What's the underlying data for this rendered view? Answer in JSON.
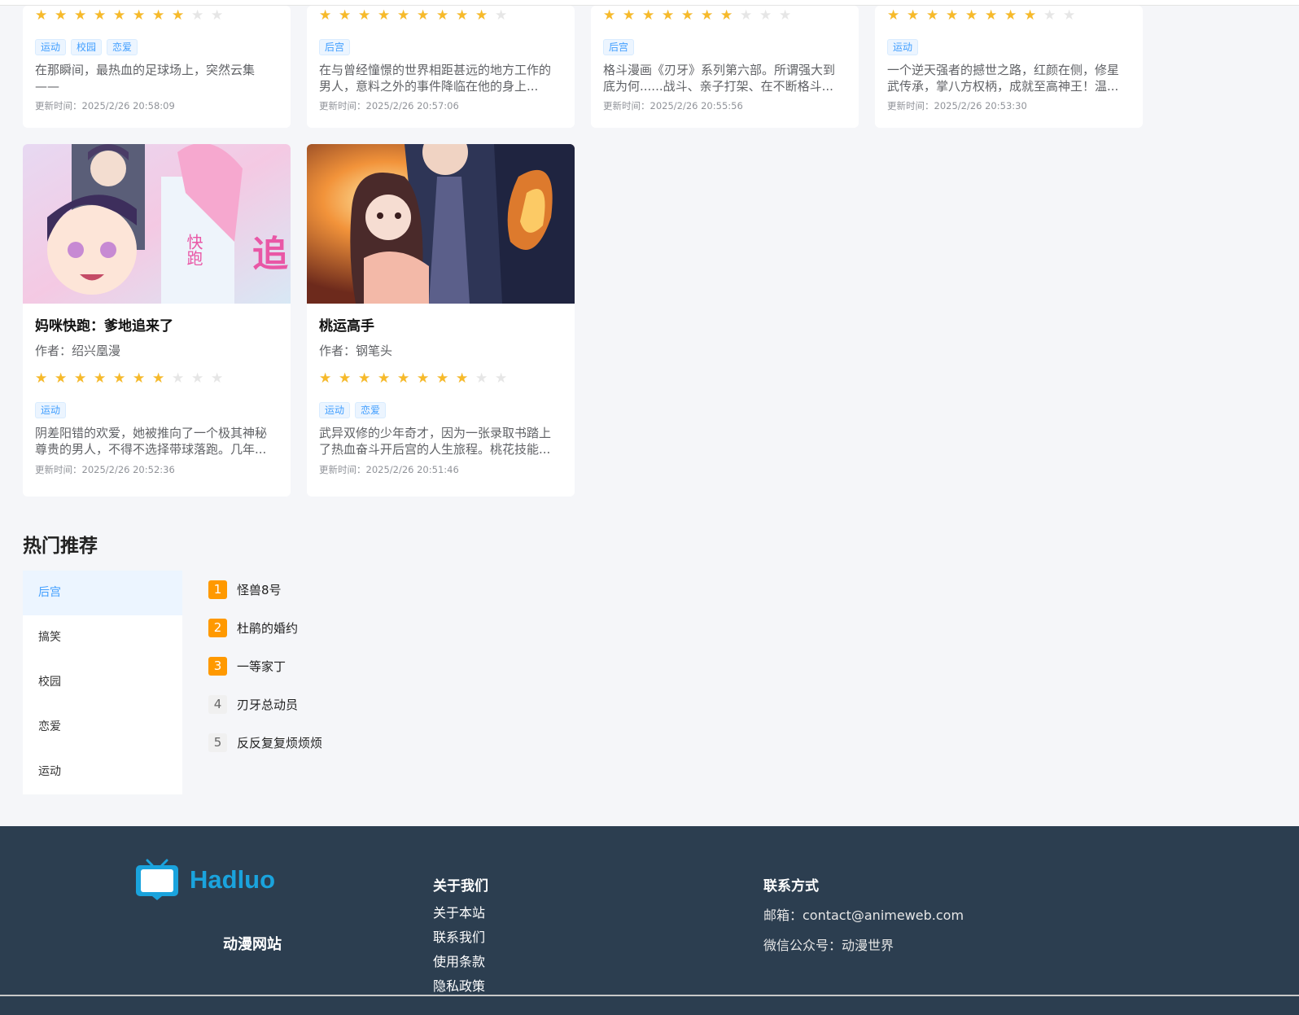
{
  "top_cards": [
    {
      "rating": 4,
      "tags": [
        "运动",
        "校园",
        "恋爱"
      ],
      "desc": "在那瞬间，最热血的足球场上，突然云集——",
      "time": "更新时间：2025/2/26 20:58:09"
    },
    {
      "rating": 4.5,
      "tags": [
        "后宫"
      ],
      "desc": "在与曾经憧憬的世界相距甚远的地方工作的男人，意料之外的事件降临在他的身上...",
      "time": "更新时间：2025/2/26 20:57:06"
    },
    {
      "rating": 3.5,
      "tags": [
        "后宫"
      ],
      "desc": "格斗漫画《刃牙》系列第六部。所谓强大到底为何......战斗、亲子打架、在不断格斗...",
      "time": "更新时间：2025/2/26 20:55:56"
    },
    {
      "rating": 4,
      "tags": [
        "运动"
      ],
      "desc": "一个逆天强者的撼世之路，红颜在侧，修星武传承，掌八方权柄，成就至高神王！温...",
      "time": "更新时间：2025/2/26 20:53:30"
    }
  ],
  "full_cards": [
    {
      "title": "妈咪快跑：爹地追来了",
      "author": "作者：绍兴凰漫",
      "rating": 3.5,
      "tags": [
        "运动"
      ],
      "desc": "阴差阳错的欢爱，她被推向了一个极其神秘尊贵的男人，不得不选择带球落跑。几年...",
      "time": "更新时间：2025/2/26 20:52:36",
      "cover_text": "妈咪快跑 追来"
    },
    {
      "title": "桃运高手",
      "author": "作者：钢笔头",
      "rating": 4,
      "tags": [
        "运动",
        "恋爱"
      ],
      "desc": "武异双修的少年奇才，因为一张录取书踏上了热血奋斗开后宫的人生旅程。桃花技能...",
      "time": "更新时间：2025/2/26 20:51:46",
      "cover_text": ""
    }
  ],
  "star_glyph": "★",
  "hot": {
    "title": "热门推荐",
    "categories": [
      "后宫",
      "搞笑",
      "校园",
      "恋爱",
      "运动"
    ],
    "active_category": "后宫",
    "ranks": [
      {
        "num": "1",
        "name": "怪兽8号"
      },
      {
        "num": "2",
        "name": "杜鹃的婚约"
      },
      {
        "num": "3",
        "name": "一等家丁"
      },
      {
        "num": "4",
        "name": "刃牙总动员"
      },
      {
        "num": "5",
        "name": "反反复复烦烦烦"
      }
    ]
  },
  "footer": {
    "logo_text": "Hadluo",
    "site_name": "动漫网站",
    "about_title": "关于我们",
    "about_links": [
      "关于本站",
      "联系我们",
      "使用条款",
      "隐私政策"
    ],
    "contact_title": "联系方式",
    "email": "邮箱：contact@animeweb.com",
    "wechat": "微信公众号：动漫世界"
  },
  "colors": {
    "accent": "#409eff",
    "star": "#f7ba2a",
    "rank_hot": "#ff9900",
    "footer_bg": "#2c3e50",
    "logo": "#1aa3dd"
  }
}
